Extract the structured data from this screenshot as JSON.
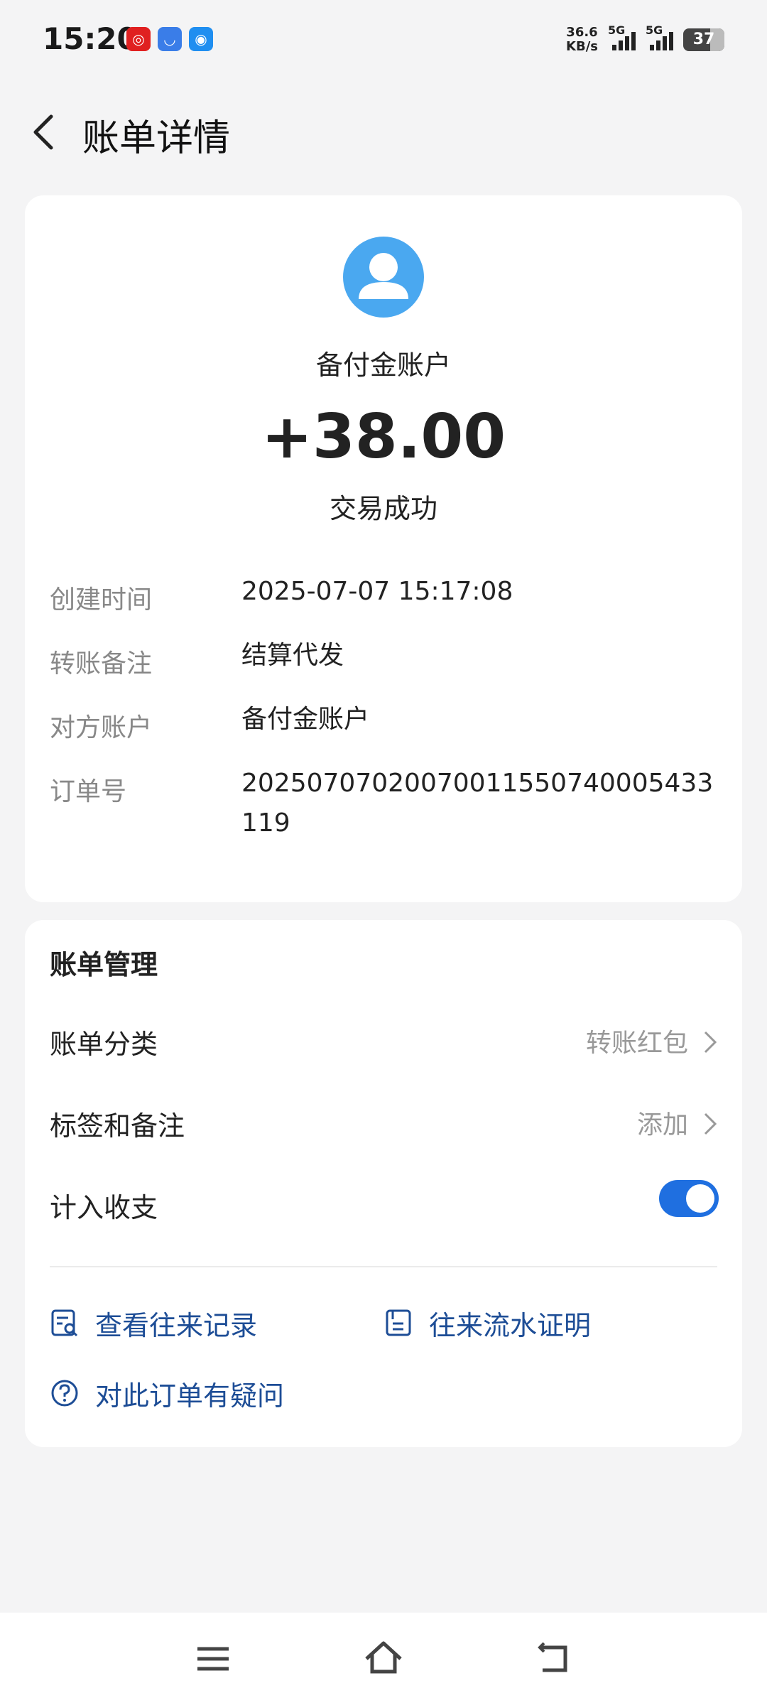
{
  "status_bar": {
    "time": "15:20",
    "net_speed_value": "36.6",
    "net_speed_unit": "KB/s",
    "signal1_label": "5G",
    "signal2_label": "5G",
    "battery": "37",
    "app_icons": [
      "netease-music-icon",
      "qq-icon",
      "hotspot-icon"
    ]
  },
  "header": {
    "title": "账单详情"
  },
  "summary": {
    "account_name": "备付金账户",
    "amount": "+38.00",
    "status": "交易成功",
    "avatar_color": "#4aa8f0"
  },
  "details": [
    {
      "label": "创建时间",
      "value": "2025-07-07 15:17:08"
    },
    {
      "label": "转账备注",
      "value": "结算代发"
    },
    {
      "label": "对方账户",
      "value": "备付金账户"
    },
    {
      "label": "订单号",
      "value": "20250707020070011550740005433119"
    }
  ],
  "management": {
    "title": "账单管理",
    "category": {
      "label": "账单分类",
      "value": "转账红包"
    },
    "tags": {
      "label": "标签和备注",
      "value": "添加"
    },
    "include": {
      "label": "计入收支",
      "enabled": true
    },
    "links": {
      "history": "查看往来记录",
      "statement": "往来流水证明",
      "question": "对此订单有疑问"
    },
    "accent_color": "#1f6fe0"
  }
}
